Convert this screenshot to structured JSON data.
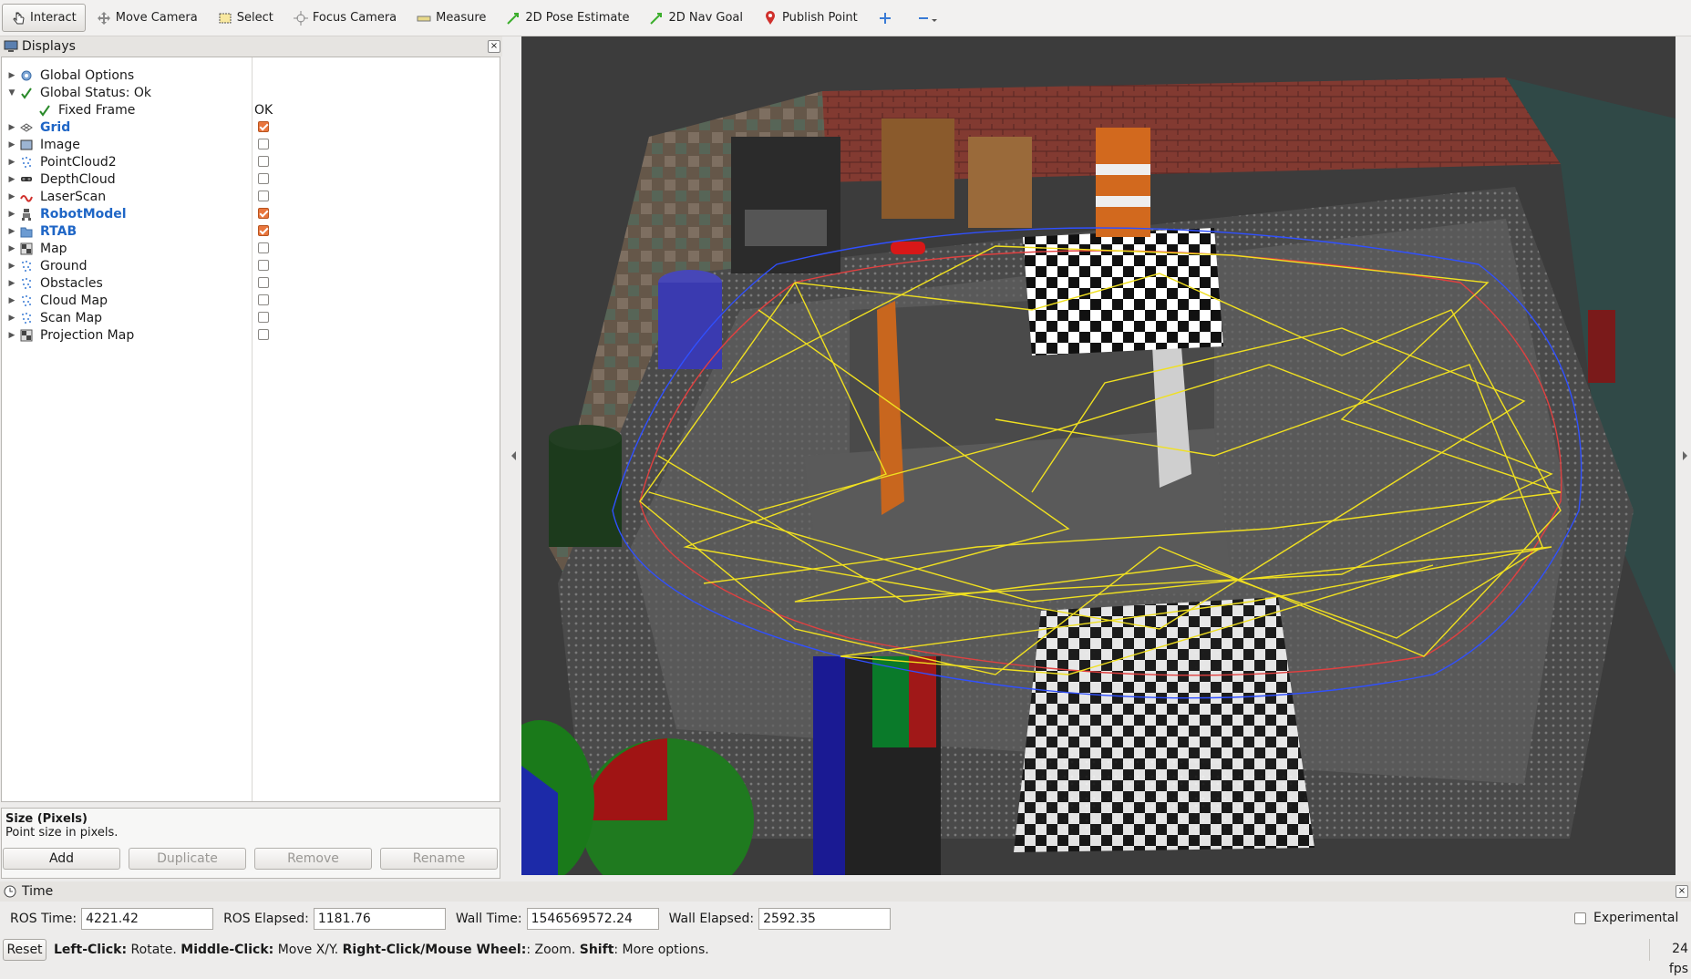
{
  "toolbar": {
    "tools": [
      {
        "label": "Interact",
        "icon": "hand-pointer-icon",
        "active": true
      },
      {
        "label": "Move Camera",
        "icon": "move-camera-icon"
      },
      {
        "label": "Select",
        "icon": "select-box-icon"
      },
      {
        "label": "Focus Camera",
        "icon": "focus-crosshair-icon"
      },
      {
        "label": "Measure",
        "icon": "ruler-icon"
      },
      {
        "label": "2D Pose Estimate",
        "icon": "green-arrow-icon"
      },
      {
        "label": "2D Nav Goal",
        "icon": "green-arrow-icon"
      },
      {
        "label": "Publish Point",
        "icon": "map-pin-icon"
      }
    ]
  },
  "displays": {
    "title": "Displays",
    "items": [
      {
        "label": "Global Options",
        "icon": "gear-icon",
        "expanded": false
      },
      {
        "label": "Global Status: Ok",
        "icon": "check-icon",
        "expanded": true
      },
      {
        "label": "Fixed Frame",
        "icon": "check-icon",
        "value": "OK",
        "child": true
      },
      {
        "label": "Grid",
        "icon": "grid-icon",
        "checked": true,
        "highlight": true
      },
      {
        "label": "Image",
        "icon": "image-icon",
        "checked": false
      },
      {
        "label": "PointCloud2",
        "icon": "pointcloud-icon",
        "checked": false
      },
      {
        "label": "DepthCloud",
        "icon": "depthcloud-icon",
        "checked": false
      },
      {
        "label": "LaserScan",
        "icon": "laserscan-icon",
        "checked": false
      },
      {
        "label": "RobotModel",
        "icon": "robot-icon",
        "checked": true,
        "highlight": true
      },
      {
        "label": "RTAB",
        "icon": "folder-icon",
        "checked": true,
        "highlight": true
      },
      {
        "label": "Map",
        "icon": "map-icon",
        "checked": false
      },
      {
        "label": "Ground",
        "icon": "pointcloud-icon",
        "checked": false
      },
      {
        "label": "Obstacles",
        "icon": "pointcloud-icon",
        "checked": false
      },
      {
        "label": "Cloud Map",
        "icon": "pointcloud-icon",
        "checked": false
      },
      {
        "label": "Scan Map",
        "icon": "pointcloud-icon",
        "checked": false
      },
      {
        "label": "Projection Map",
        "icon": "map-icon",
        "checked": false
      }
    ],
    "description_title": "Size (Pixels)",
    "description_text": "Point size in pixels.",
    "buttons": {
      "add": "Add",
      "duplicate": "Duplicate",
      "remove": "Remove",
      "rename": "Rename"
    }
  },
  "time": {
    "title": "Time",
    "ros_time_label": "ROS Time:",
    "ros_time": "4221.42",
    "ros_elapsed_label": "ROS Elapsed:",
    "ros_elapsed": "1181.76",
    "wall_time_label": "Wall Time:",
    "wall_time": "1546569572.24",
    "wall_elapsed_label": "Wall Elapsed:",
    "wall_elapsed": "2592.35",
    "experimental_label": "Experimental"
  },
  "status": {
    "reset": "Reset",
    "hint_1b": "Left-Click:",
    "hint_1": " Rotate. ",
    "hint_2b": "Middle-Click:",
    "hint_2": " Move X/Y. ",
    "hint_3b": "Right-Click/Mouse Wheel:",
    "hint_3": ": Zoom. ",
    "hint_4b": "Shift",
    "hint_4": ": More options.",
    "fps": "24 fps"
  },
  "colors": {
    "checked": "#e9763d",
    "highlight": "#1f66c6"
  }
}
